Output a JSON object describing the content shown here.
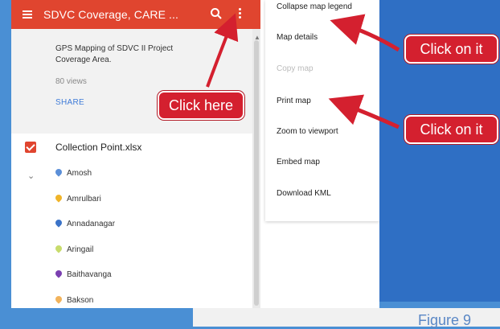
{
  "app": {
    "title": "SDVC Coverage, CARE ...",
    "description": "GPS Mapping of SDVC II Project Coverage Area.",
    "views": "80 views",
    "share": "SHARE"
  },
  "layer": {
    "name": "Collection Point.xlsx",
    "places": [
      {
        "label": "Amosh",
        "color": "#5b8fd8"
      },
      {
        "label": "Amrulbari",
        "color": "#f0b429"
      },
      {
        "label": "Annadanagar",
        "color": "#3b73c8"
      },
      {
        "label": "Aringail",
        "color": "#c8dc6c"
      },
      {
        "label": "Baithavanga",
        "color": "#7a3fb0"
      },
      {
        "label": "Bakson",
        "color": "#f2b35b"
      }
    ]
  },
  "menu": {
    "items": [
      {
        "label": "Collapse map legend",
        "disabled": false
      },
      {
        "label": "Map details",
        "disabled": false
      },
      {
        "label": "Copy map",
        "disabled": true
      },
      {
        "label": "Print map",
        "disabled": false
      },
      {
        "label": "Zoom to viewport",
        "disabled": false
      },
      {
        "label": "Embed map",
        "disabled": false
      },
      {
        "label": "Download KML",
        "disabled": false
      }
    ]
  },
  "annotations": {
    "click_here": "Click here",
    "click_on_it_1": "Click on it",
    "click_on_it_2": "Click on it"
  },
  "caption": "Figure 9",
  "colors": {
    "accent": "#e0452f",
    "callout": "#d4202f",
    "background": "#4a8fd4"
  }
}
